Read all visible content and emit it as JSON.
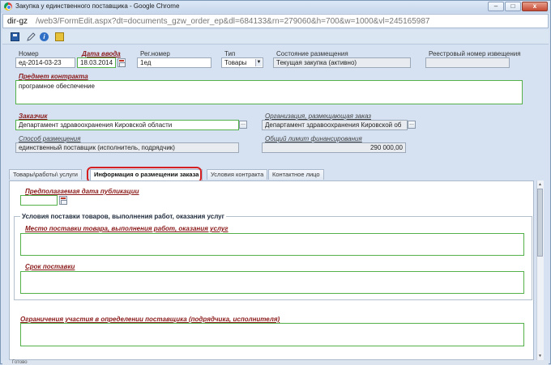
{
  "window": {
    "title": "Закупка у единственного поставщика - Google Chrome",
    "url_domain": "dir-gz",
    "url_path": "/web3/FormEdit.aspx?dt=documents_gzw_order_ep&dl=684133&rn=279060&h=700&w=1000&vl=245165987"
  },
  "header": {
    "nomer_label": "Номер",
    "nomer_value": "ед-2014-03-23",
    "data_vvoda_label": "Дата ввода",
    "data_vvoda_value": "18.03.2014",
    "reg_nomer_label": "Рег.номер",
    "reg_nomer_value": "1ед",
    "tip_label": "Тип",
    "tip_value": "Товары",
    "sostoyanie_label": "Состояние размещения",
    "sostoyanie_value": "Текущая закупка (активно)",
    "reestr_label": "Реестровый номер извещения",
    "reestr_value": ""
  },
  "predmet": {
    "label": "Предмет контракта",
    "value": "програмное обеспечение"
  },
  "zakazchik": {
    "label": "Заказчик",
    "value": "Департамент здравоохранения Кировской области"
  },
  "organizatsiya": {
    "label": "Организация, размещающая заказ",
    "value": "Департамент здравоохранения Кировской об"
  },
  "sposob": {
    "label": "Способ размещения",
    "value": "единственный поставщик (исполнитель, подрядчик)"
  },
  "limit": {
    "label": "Общий лимит финансирования",
    "value": "290 000,00"
  },
  "tabs": [
    {
      "label": "Товары\\работы\\ услуги"
    },
    {
      "label": "Информация о размещении заказа"
    },
    {
      "label": "Условия контракта"
    },
    {
      "label": "Контактное лицо"
    }
  ],
  "panel": {
    "pub_date_label": "Предполагаемая дата публикации",
    "pub_date_value": "",
    "fieldset_legend": "Условия поставки товаров, выполнения работ, оказания услуг",
    "mesto_label": "Место поставки товара, выполнения работ, оказания услуг",
    "srok_label": "Срок поставки",
    "ogranicheniya_label": "Ограничения участия в определении поставщика (подрядчика, исполнителя)"
  },
  "status": {
    "text": "Готово"
  }
}
